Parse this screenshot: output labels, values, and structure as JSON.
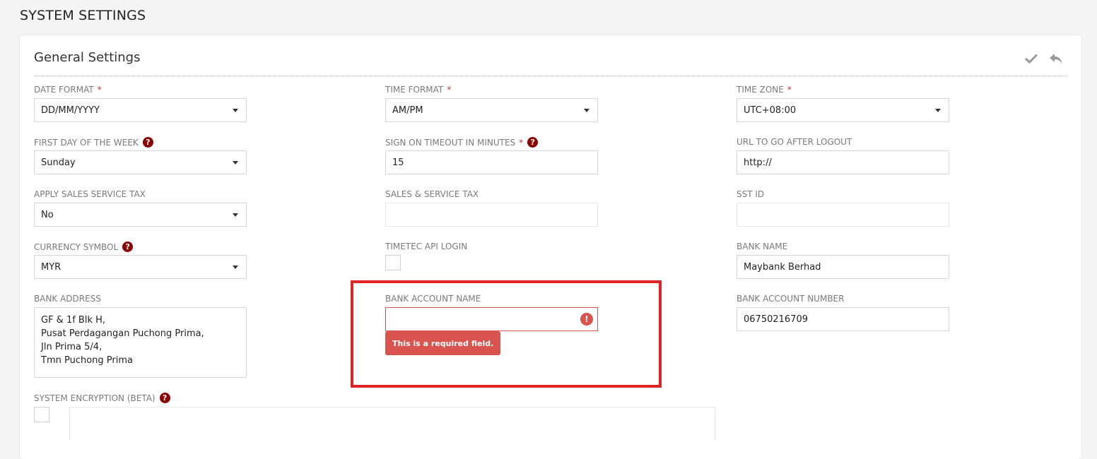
{
  "page": {
    "title": "SYSTEM SETTINGS"
  },
  "card": {
    "title": "General Settings"
  },
  "header_actions": {
    "save_icon": "check-icon",
    "back_icon": "reply-icon"
  },
  "colors": {
    "required": "#c9302c",
    "error": "#d9534f",
    "help": "#8b0000",
    "highlight": "#e02424"
  },
  "fields": {
    "date_format": {
      "label": "DATE FORMAT",
      "required": "*",
      "value": "DD/MM/YYYY"
    },
    "time_format": {
      "label": "TIME FORMAT",
      "required": "*",
      "value": "AM/PM"
    },
    "time_zone": {
      "label": "TIME ZONE",
      "required": "*",
      "value": "UTC+08:00"
    },
    "first_day": {
      "label": "FIRST DAY OF THE WEEK",
      "help": "?",
      "value": "Sunday"
    },
    "sign_on_timeout": {
      "label": "SIGN ON TIMEOUT IN MINUTES",
      "required": "*",
      "help": "?",
      "value": "15"
    },
    "url_logout": {
      "label": "URL TO GO AFTER LOGOUT",
      "value": "http://"
    },
    "apply_sst": {
      "label": "APPLY SALES SERVICE TAX",
      "value": "No"
    },
    "sales_service_tax": {
      "label": "SALES & SERVICE TAX",
      "value": ""
    },
    "sst_id": {
      "label": "SST ID",
      "value": ""
    },
    "currency": {
      "label": "CURRENCY SYMBOL",
      "help": "?",
      "value": "MYR"
    },
    "timetec_api": {
      "label": "TIMETEC API LOGIN"
    },
    "bank_name": {
      "label": "BANK NAME",
      "value": "Maybank Berhad"
    },
    "bank_address": {
      "label": "BANK ADDRESS",
      "value": "GF & 1f Blk H,\nPusat Perdagangan Puchong Prima,\nJln Prima 5/4,\nTmn Puchong Prima"
    },
    "bank_account_name": {
      "label": "BANK ACCOUNT NAME",
      "value": "",
      "error_icon": "!",
      "error": "This is a required field."
    },
    "bank_account_number": {
      "label": "BANK ACCOUNT NUMBER",
      "value": "06750216709"
    },
    "system_encryption": {
      "label": "SYSTEM ENCRYPTION (BETA)",
      "help": "?"
    }
  }
}
